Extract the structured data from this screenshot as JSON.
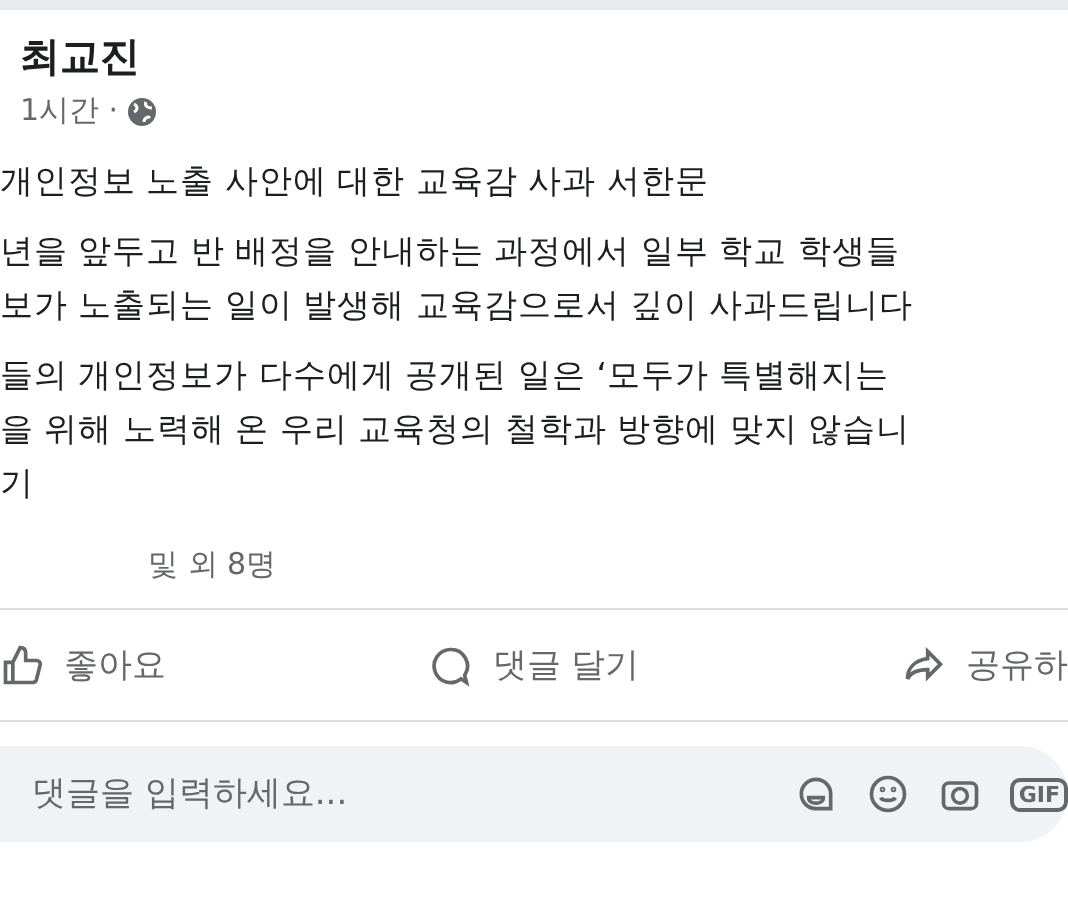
{
  "post": {
    "author": "최교진",
    "time": "1시간 ·",
    "title": "개인정보 노출 사안에 대한 교육감 사과 서한문",
    "paragraphs": [
      [
        "년을 앞두고 반 배정을 안내하는 과정에서 일부 학교 학생들",
        "보가 노출되는 일이 발생해 교육감으로서 깊이 사과드립니다"
      ],
      [
        "들의 개인정보가 다수에게 공개된 일은 ‘모두가 특별해지는",
        "을 위해 노력해 온 우리 교육청의 철학과 방향에 맞지 않습니",
        "기"
      ]
    ],
    "reactions": "및 외 8명"
  },
  "actions": [
    {
      "kind": "like",
      "label": "좋아요"
    },
    {
      "kind": "comment",
      "label": "댓글 달기"
    },
    {
      "kind": "share",
      "label": "공유하"
    }
  ],
  "comment_box": {
    "placeholder": "댓글을 입력하세요...",
    "tools": [
      {
        "kind": "sticker"
      },
      {
        "kind": "emoji"
      },
      {
        "kind": "camera"
      },
      {
        "kind": "gif",
        "label": "GIF"
      }
    ]
  }
}
